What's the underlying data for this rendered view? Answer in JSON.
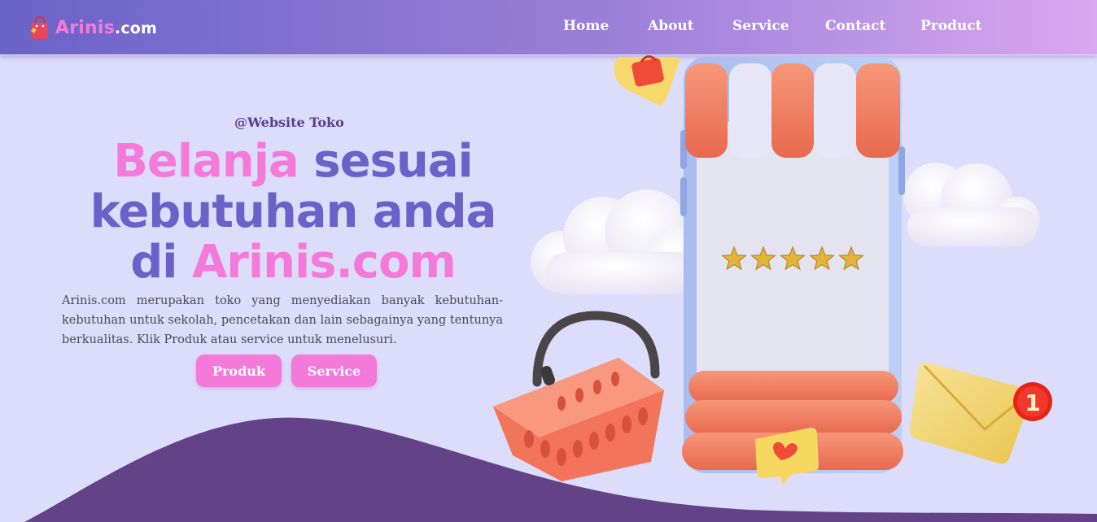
{
  "brand": {
    "name_main": "Arinis",
    "name_tld": ".com",
    "icon": "shopping-bag-icon"
  },
  "nav": {
    "items": [
      "Home",
      "About",
      "Service",
      "Contact",
      "Product"
    ]
  },
  "hero": {
    "tagline": "@Website Toko",
    "title_pink_1": "Belanja",
    "title_rest_1": " sesuai",
    "title_line_2": "kebutuhan anda",
    "title_prefix_3": "di ",
    "title_pink_3": "Arinis.com",
    "description": "Arinis.com merupakan toko yang menyediakan banyak kebutuhan-kebutuhan untuk sekolah, pencetakan dan lain sebagainya yang tentunya berkualitas. Klik Produk atau service untuk menelusuri.",
    "buttons": {
      "primary": "Produk",
      "secondary": "Service"
    }
  },
  "illustration": {
    "rating_stars": 5,
    "notification_count": "1"
  },
  "colors": {
    "accent_pink": "#f47ad9",
    "accent_indigo": "#6b61c8",
    "wave_purple": "#644287",
    "background": "#dcdcfb"
  }
}
